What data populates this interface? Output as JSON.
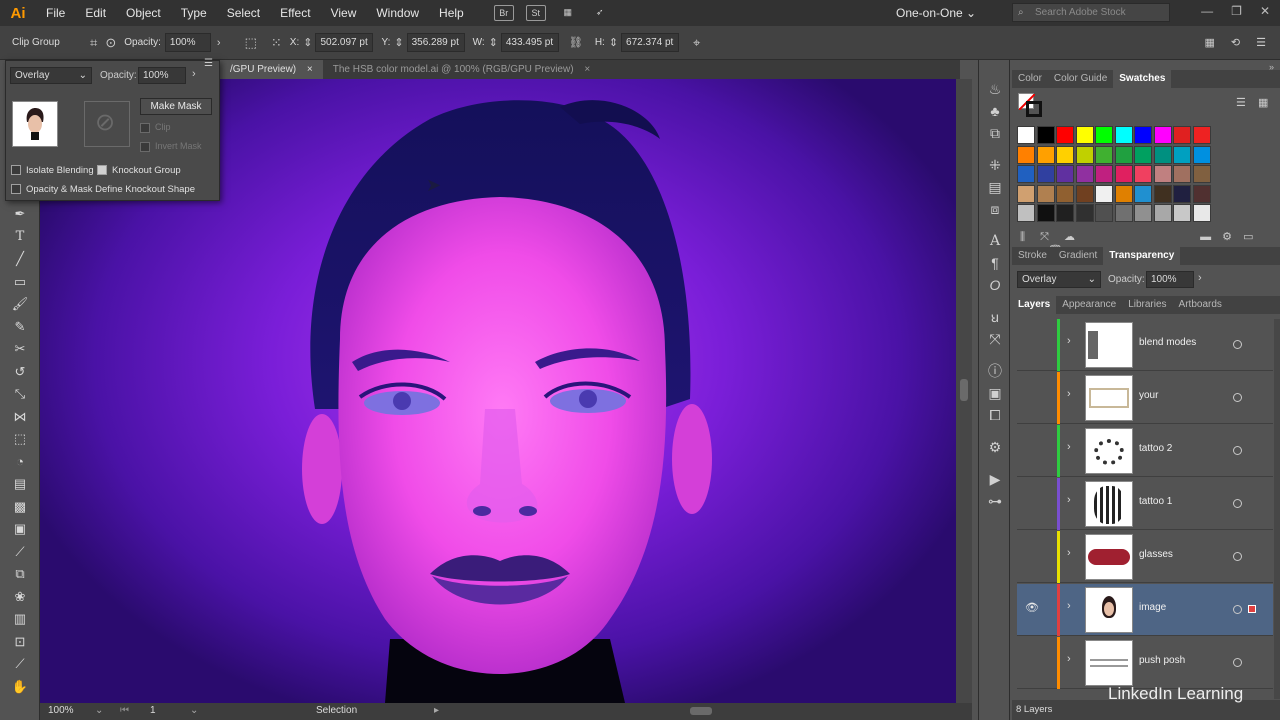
{
  "app": {
    "logo": "Ai",
    "workspace": "One-on-One",
    "stock_search_placeholder": "Search Adobe Stock"
  },
  "menu": [
    "File",
    "Edit",
    "Object",
    "Type",
    "Select",
    "Effect",
    "View",
    "Window",
    "Help"
  ],
  "menu_icons": [
    "Br",
    "St"
  ],
  "control_bar": {
    "selection_label": "Clip Group",
    "opacity_label": "Opacity:",
    "opacity_value": "100%",
    "x_label": "X:",
    "x_value": "502.097 pt",
    "y_label": "Y:",
    "y_value": "356.289 pt",
    "w_label": "W:",
    "w_value": "433.495 pt",
    "h_label": "H:",
    "h_value": "672.374 pt"
  },
  "tabs": [
    {
      "label": "/GPU Preview)",
      "close": "×",
      "active": true
    },
    {
      "label": "The HSB color model.ai @ 100% (RGB/GPU Preview)",
      "close": "×",
      "active": false
    }
  ],
  "transparency_flyout": {
    "blend_mode": "Overlay",
    "opacity_label": "Opacity:",
    "opacity_value": "100%",
    "make_mask": "Make Mask",
    "clip": "Clip",
    "invert_mask": "Invert Mask",
    "isolate_blending": "Isolate Blending",
    "knockout_group": "Knockout Group",
    "opacity_mask_define": "Opacity & Mask Define Knockout Shape"
  },
  "right_panels": {
    "color_tabs": [
      "Color",
      "Color Guide",
      "Swatches"
    ],
    "active_color_tab": "Swatches",
    "stroke_tabs": [
      "Stroke",
      "Gradient",
      "Transparency"
    ],
    "transparency_blend": "Overlay",
    "transparency_opacity_label": "Opacity:",
    "transparency_opacity": "100%",
    "layer_tabs": [
      "Layers",
      "Appearance",
      "Libraries",
      "Artboards"
    ],
    "layers": [
      {
        "name": "blend modes",
        "color": "#2ecc40",
        "selected": false
      },
      {
        "name": "your",
        "color": "#ff8c00",
        "selected": false
      },
      {
        "name": "tattoo 2",
        "color": "#2ecc40",
        "selected": false
      },
      {
        "name": "tattoo 1",
        "color": "#7a4fd0",
        "selected": false
      },
      {
        "name": "glasses",
        "color": "#e8e000",
        "selected": false
      },
      {
        "name": "image",
        "color": "#e04040",
        "selected": true
      },
      {
        "name": "push posh",
        "color": "#ff8c00",
        "selected": false
      }
    ],
    "layers_count": "8 Layers"
  },
  "swatches": [
    [
      "#ffffff",
      "#000000",
      "#ff0000",
      "#ffff00",
      "#00ff00",
      "#00ffff",
      "#0000ff",
      "#ff00ff",
      "#e02020",
      "#ee2222"
    ],
    [
      "#ff8000",
      "#ffa000",
      "#ffd000",
      "#c0d000",
      "#40b030",
      "#20a040",
      "#00a060",
      "#009080",
      "#00a0c0",
      "#0090e0"
    ],
    [
      "#2060c0",
      "#3040a0",
      "#6030a0",
      "#9030a0",
      "#c02080",
      "#e02060",
      "#f04060",
      "#c08080",
      "#a07060",
      "#806040"
    ],
    [
      "#d0a070",
      "#b08050",
      "#906030",
      "#704020",
      "#f0f0f0",
      "#e08000",
      "#2090d0",
      "#403020",
      "#202040",
      "#503030"
    ],
    [
      "#c0c0c0",
      "#101010",
      "#202020",
      "#303030",
      "#505050",
      "#707070",
      "#909090",
      "#a8a8a8",
      "#c8c8c8",
      "#e8e8e8"
    ]
  ],
  "status": {
    "zoom": "100%",
    "artboard": "1",
    "tool": "Selection"
  },
  "watermark": "LinkedIn Learning"
}
